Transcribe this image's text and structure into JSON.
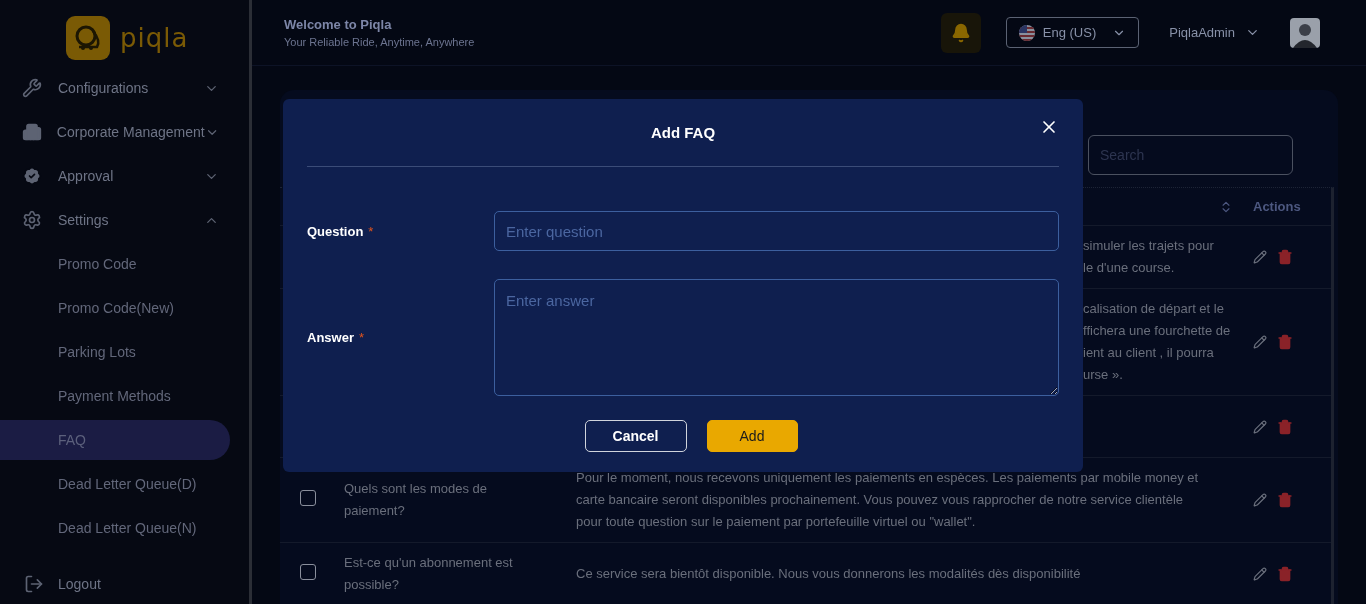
{
  "sidebar": {
    "logo": "piqla",
    "menu": [
      {
        "label": "Configurations",
        "expanded": false
      },
      {
        "label": "Corporate Management",
        "expanded": false
      },
      {
        "label": "Approval",
        "expanded": false
      },
      {
        "label": "Settings",
        "expanded": true,
        "children": [
          {
            "label": "Promo Code",
            "selected": false
          },
          {
            "label": "Promo Code(New)",
            "selected": false
          },
          {
            "label": "Parking Lots",
            "selected": false
          },
          {
            "label": "Payment Methods",
            "selected": false
          },
          {
            "label": "FAQ",
            "selected": true
          },
          {
            "label": "Dead Letter Queue(D)",
            "selected": false
          },
          {
            "label": "Dead Letter Queue(N)",
            "selected": false
          }
        ]
      }
    ],
    "logout": "Logout"
  },
  "header": {
    "title": "Welcome to Piqla",
    "subtitle": "Your Reliable Ride, Anytime, Anywhere",
    "language": "Eng (US)",
    "user": "PiqlaAdmin"
  },
  "faq_table": {
    "search": {
      "placeholder": "Search"
    },
    "actions_column": "Actions",
    "rows": [
      {
        "answer_lines": [
          "simuler les trajets pour",
          "le d'une course."
        ]
      },
      {
        "answer_lines": [
          "calisation de départ et le",
          "ffichera une fourchette de",
          "ient au client , il pourra",
          "urse »."
        ]
      },
      {
        "answer_lines": []
      },
      {
        "checked": false,
        "question": "Quels sont les modes de paiement?",
        "answer_lines": [
          "Pour le moment, nous recevons uniquement les paiements en espèces. Les paiements par mobile money et",
          "carte bancaire seront disponibles prochainement. Vous pouvez vous rapprocher de notre service clientèle",
          "pour toute question sur le paiement par portefeuille virtuel ou \"wallet\"."
        ]
      },
      {
        "checked": false,
        "question": "Est-ce qu'un abonnement est possible?",
        "answer_lines": [
          "Ce service sera bientôt disponible. Nous vous donnerons les modalités dès disponibilité"
        ]
      }
    ]
  },
  "modal": {
    "title": "Add FAQ",
    "fields": [
      {
        "label": "Question",
        "required_mark": "*",
        "kind": "input",
        "placeholder": "Enter question"
      },
      {
        "label": "Answer",
        "required_mark": "*",
        "kind": "textarea",
        "placeholder": "Enter answer"
      }
    ],
    "buttons": [
      {
        "label": "Cancel",
        "kind": "secondary"
      },
      {
        "label": "Add",
        "kind": "primary"
      }
    ]
  }
}
